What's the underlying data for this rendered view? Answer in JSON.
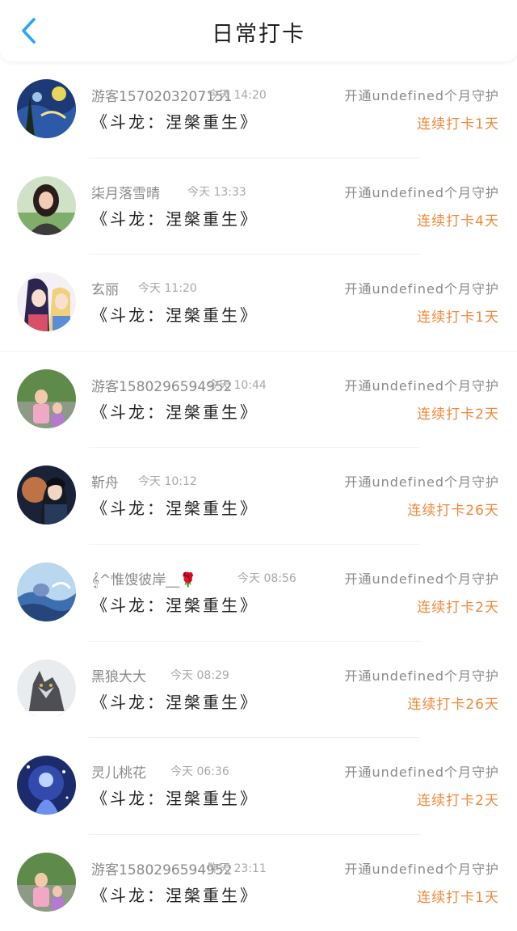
{
  "header": {
    "title": "日常打卡"
  },
  "rows": [
    {
      "user": "游客15702032071​51",
      "time": "今天 14:20",
      "book": "《斗龙：涅槃重生》",
      "guard": "开通undefined个月守护",
      "streak": "连续打卡1天"
    },
    {
      "user": "柒月落雪晴",
      "time": "今天 13:33",
      "book": "《斗龙：涅槃重生》",
      "guard": "开通undefined个月守护",
      "streak": "连续打卡4天"
    },
    {
      "user": "玄丽",
      "time": "今天 11:20",
      "book": "《斗龙：涅槃重生》",
      "guard": "开通undefined个月守护",
      "streak": "连续打卡1天"
    },
    {
      "user": "游客1580296594952",
      "time": "今天 10:44",
      "book": "《斗龙：涅槃重生》",
      "guard": "开通undefined个月守护",
      "streak": "连续打卡2天"
    },
    {
      "user": "靳舟",
      "time": "今天 10:12",
      "book": "《斗龙：涅槃重生》",
      "guard": "开通undefined个月守护",
      "streak": "连续打卡26天"
    },
    {
      "user": "𝄞^惟馊彼岸__🌹",
      "time": "今天 08:56",
      "book": "《斗龙：涅槃重生》",
      "guard": "开通undefined个月守护",
      "streak": "连续打卡2天"
    },
    {
      "user": "黑狼大大",
      "time": "今天 08:29",
      "book": "《斗龙：涅槃重生》",
      "guard": "开通undefined个月守护",
      "streak": "连续打卡26天"
    },
    {
      "user": "灵儿桃花",
      "time": "今天 06:36",
      "book": "《斗龙：涅槃重生》",
      "guard": "开通undefined个月守护",
      "streak": "连续打卡2天"
    },
    {
      "user": "游客1580296594952",
      "time": "昨天 23:11",
      "book": "《斗龙：涅槃重生》",
      "guard": "开通undefined个月守护",
      "streak": "连续打卡1天"
    }
  ],
  "colors": {
    "accent_blue": "#2aa7f2",
    "streak_orange": "#f0883a"
  }
}
